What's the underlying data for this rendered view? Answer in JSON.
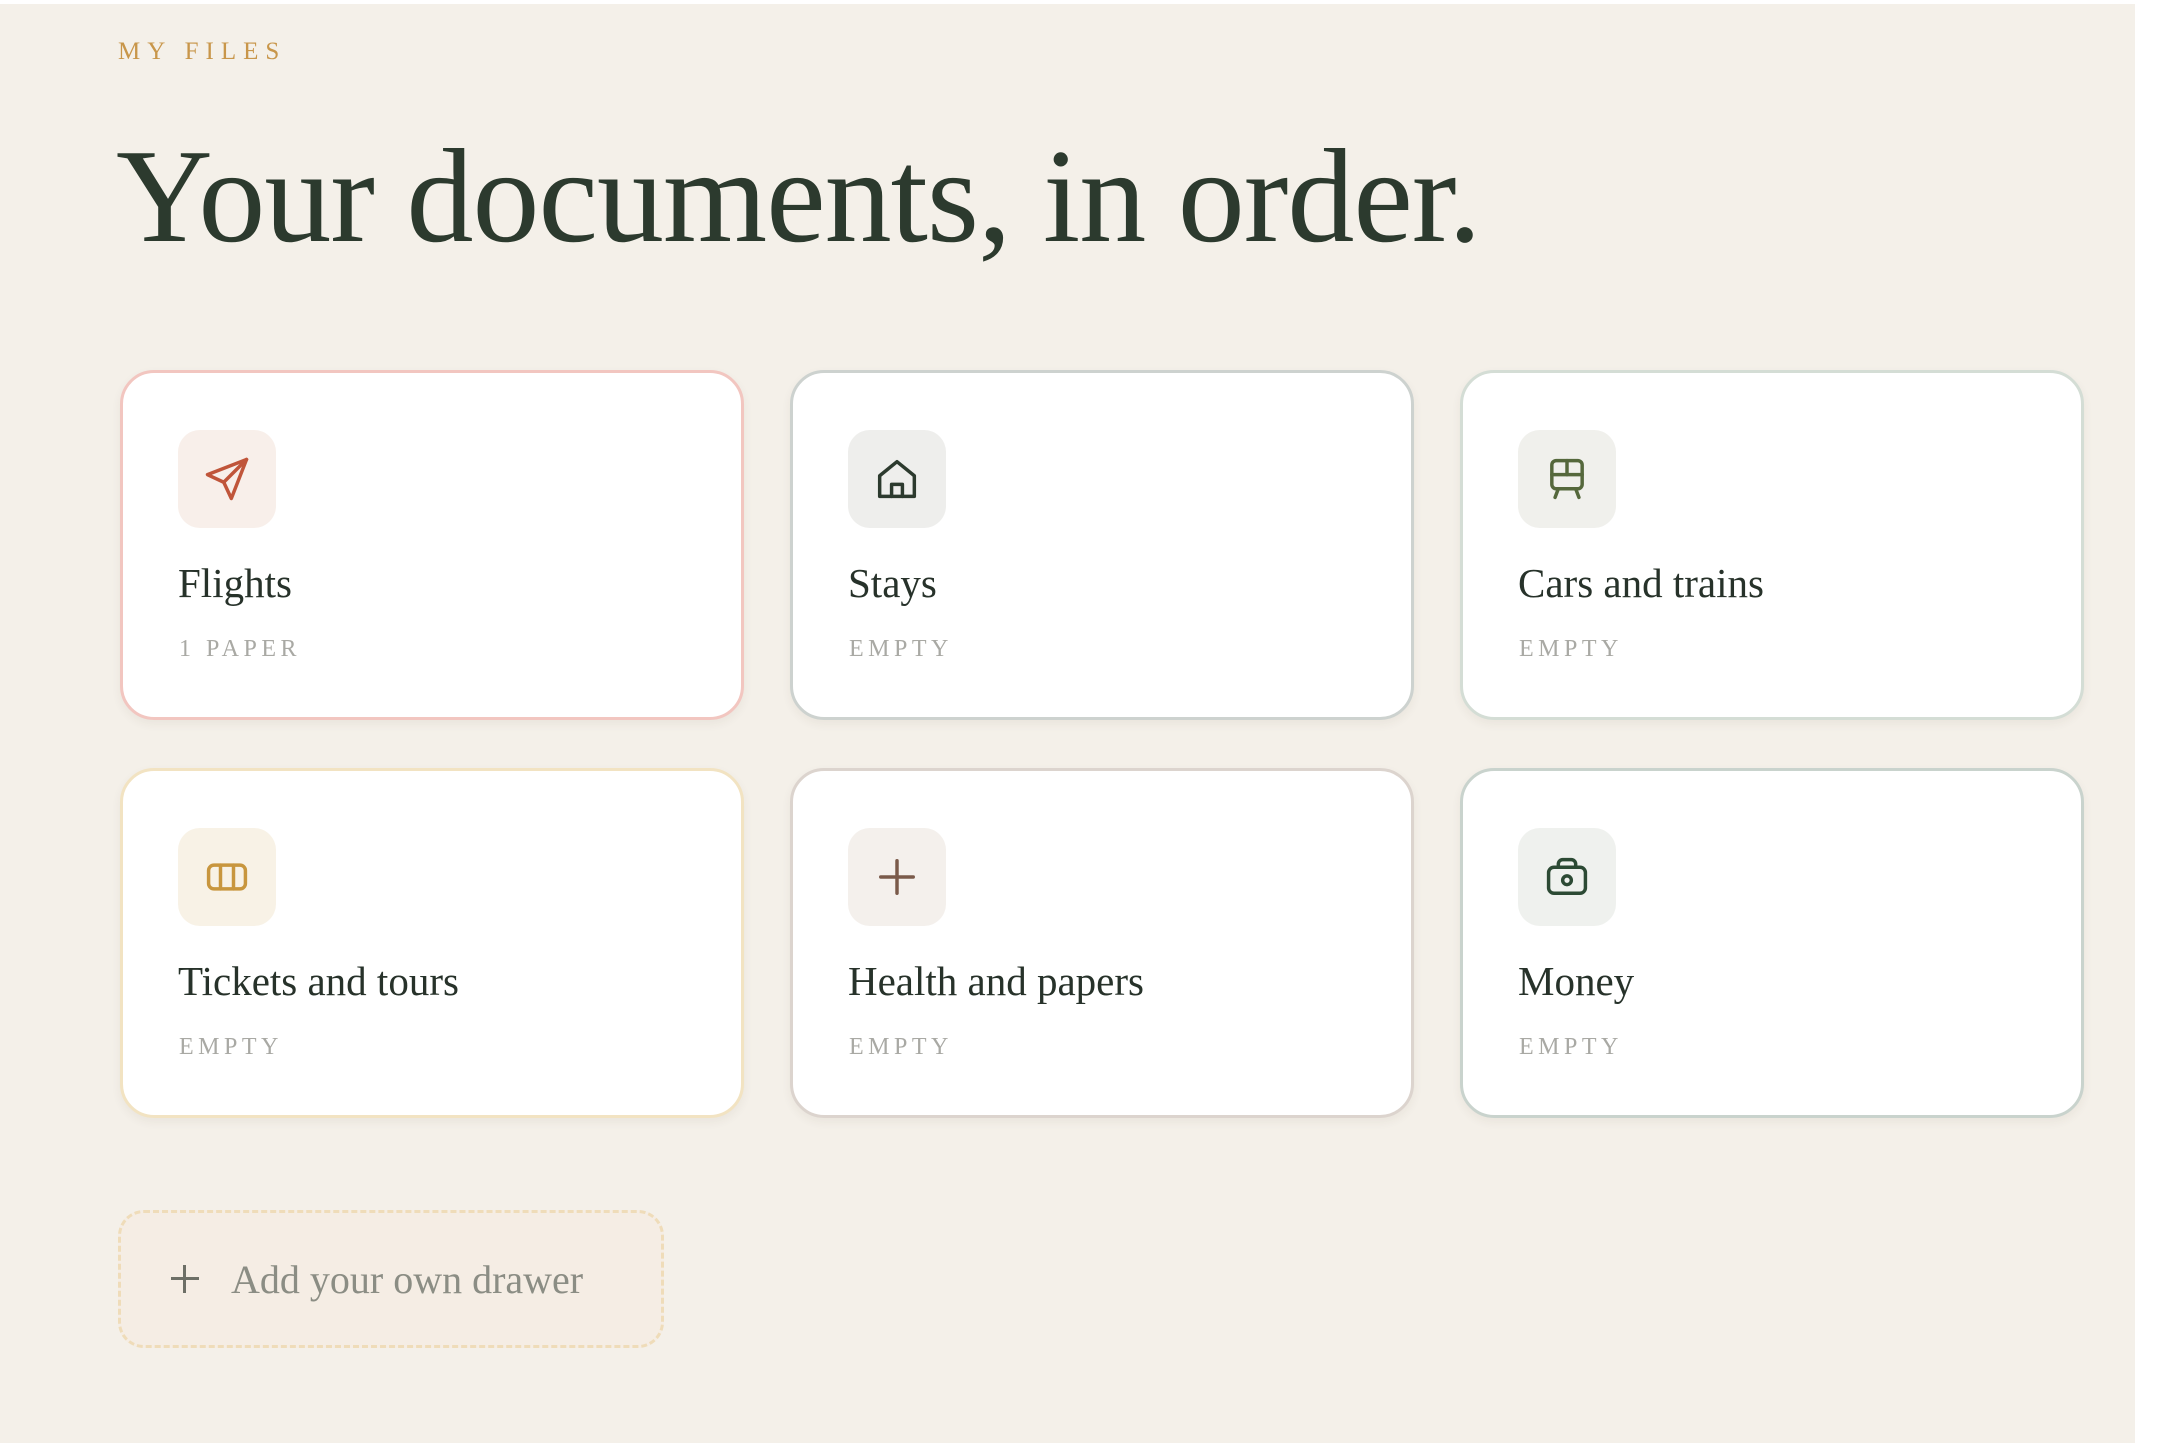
{
  "header": {
    "eyebrow": "MY FILES",
    "title": "Your documents, in order."
  },
  "drawers": [
    {
      "name": "Flights",
      "count": "1 PAPER",
      "icon": "paper-plane-icon",
      "accent": "#c0553a"
    },
    {
      "name": "Stays",
      "count": "EMPTY",
      "icon": "house-icon",
      "accent": "#2c3a2e"
    },
    {
      "name": "Cars and trains",
      "count": "EMPTY",
      "icon": "train-icon",
      "accent": "#55683c"
    },
    {
      "name": "Tickets and tours",
      "count": "EMPTY",
      "icon": "ticket-icon",
      "accent": "#c8963e"
    },
    {
      "name": "Health and papers",
      "count": "EMPTY",
      "icon": "plus-icon",
      "accent": "#7a5a4a"
    },
    {
      "name": "Money",
      "count": "EMPTY",
      "icon": "wallet-icon",
      "accent": "#2c4a34"
    }
  ],
  "add_drawer": {
    "label": "Add your own drawer"
  },
  "colors": {
    "background": "#f4f0e9",
    "eyebrow": "#c8964a",
    "title": "#2c3a2e"
  }
}
